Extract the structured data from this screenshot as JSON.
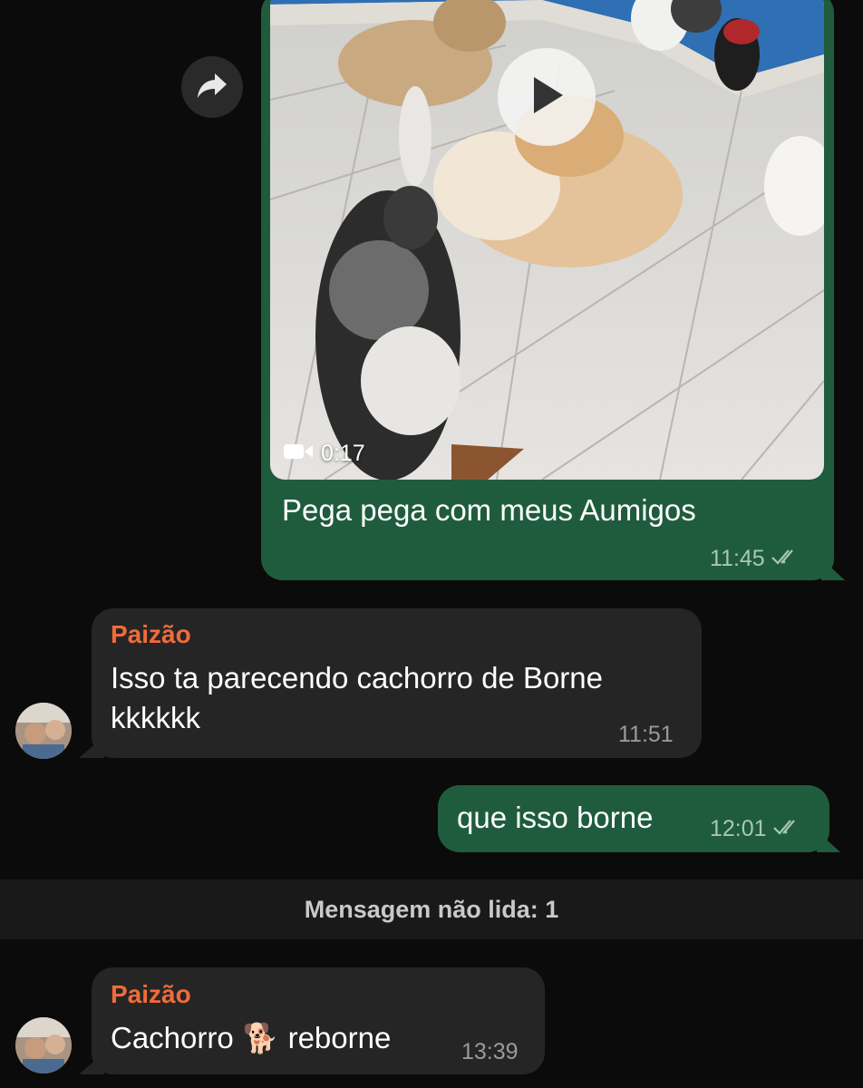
{
  "video_message": {
    "duration": "0:17",
    "caption": "Pega pega com meus Aumigos",
    "time": "11:45",
    "status_icon": "double-check-icon",
    "play_icon": "play-icon",
    "camera_icon": "video-camera-icon"
  },
  "forward": {
    "icon": "forward-arrow-icon"
  },
  "incoming_1": {
    "sender": "Paizão",
    "line1": "Isso ta parecendo cachorro de Borne",
    "line2": "kkkkkk",
    "time": "11:51"
  },
  "outgoing_2": {
    "text": "que isso borne",
    "time": "12:01"
  },
  "unread_banner": "Mensagem não lida: 1",
  "incoming_2": {
    "sender": "Paizão",
    "text_before": "Cachorro",
    "emoji": "🐕",
    "text_after": "reborne",
    "time": "13:39"
  },
  "colors": {
    "background": "#0b0b0b",
    "outgoing_bubble": "#1f5c3d",
    "incoming_bubble": "#252525",
    "sender_name": "#f26b3a",
    "unread_banner_bg": "#191919"
  }
}
